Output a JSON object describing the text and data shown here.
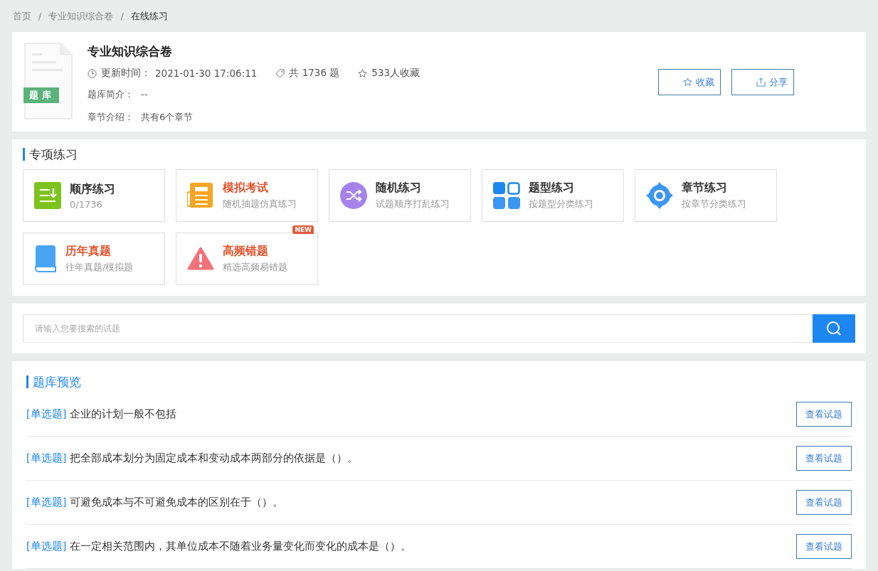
{
  "breadcrumb": [
    {
      "label": "首页",
      "current": false
    },
    {
      "separator": "/",
      "label": "专业知识综合卷",
      "current": false
    },
    {
      "separator": "/",
      "label": "在线练习",
      "current": true
    }
  ],
  "bank": {
    "badge": "题 库",
    "title": "专业知识综合卷",
    "updated_label": "更新时间：",
    "updated": "2021-01-30 17:06:11",
    "count": "共 1736 题",
    "favorites": "533人收藏",
    "intro_label": "题库简介：",
    "intro": "--",
    "chapters_label": "章节介绍：",
    "chapters": "共有6个章节"
  },
  "actions": [
    {
      "kind": "star",
      "label": "收藏"
    },
    {
      "kind": "share",
      "label": "分享"
    }
  ],
  "practice": {
    "title": "专项练习",
    "cards": [
      {
        "kind": "sequence",
        "title": "顺序练习",
        "subtitle": "0/1736",
        "highlight": false
      },
      {
        "kind": "exam",
        "title": "模拟考试",
        "subtitle": "随机抽题仿真练习",
        "highlight": true
      },
      {
        "kind": "random",
        "title": "随机练习",
        "subtitle": "试题顺序打乱练习",
        "highlight": false
      },
      {
        "kind": "type",
        "title": "题型练习",
        "subtitle": "按题型分类练习",
        "highlight": false
      },
      {
        "kind": "chapter",
        "title": "章节练习",
        "subtitle": "按章节分类练习",
        "highlight": false
      },
      {
        "kind": "past",
        "title": "历年真题",
        "subtitle": "往年真题/模拟题",
        "highlight": true
      },
      {
        "kind": "mistakes",
        "title": "高频错题",
        "subtitle": "精选高频易错题",
        "highlight": true,
        "badge": "NEW"
      }
    ]
  },
  "search": {
    "placeholder": "请输入您要搜索的试题"
  },
  "preview": {
    "title": "题库预览",
    "questions": [
      {
        "type": "[单选题]",
        "text": "企业的计划一般不包括",
        "button": "查看试题"
      },
      {
        "type": "[单选题]",
        "text": "把全部成本划分为固定成本和变动成本两部分的依据是（）。",
        "button": "查看试题"
      },
      {
        "type": "[单选题]",
        "text": "可避免成本与不可避免成本的区别在于（）。",
        "button": "查看试题"
      },
      {
        "type": "[单选题]",
        "text": "在一定相关范围内，其单位成本不随着业务量变化而变化的成本是（）。",
        "button": "查看试题"
      }
    ]
  }
}
